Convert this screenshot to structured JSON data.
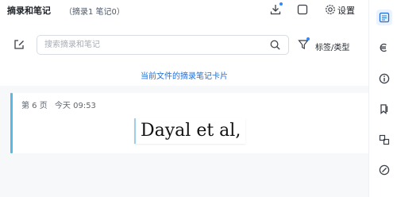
{
  "header": {
    "title": "摘录和笔记",
    "counts": "（摘录1  笔记0）",
    "settings_label": "设置"
  },
  "search": {
    "placeholder": "搜索摘录和笔记",
    "value": ""
  },
  "filter": {
    "tag_label": "标签/类型"
  },
  "link_text": "当前文件的摘录笔记卡片",
  "card": {
    "page": "第 6 页",
    "date": "今天 09:53",
    "excerpt": "Dayal et al,"
  },
  "colors": {
    "accent": "#1f6fd6",
    "card_bar": "#58b8e6",
    "dot": "#2f88ff"
  },
  "rail_icons": [
    "notes-icon",
    "translate-icon",
    "info-icon",
    "bookmark-icon",
    "ocr-icon",
    "chat-icon"
  ]
}
